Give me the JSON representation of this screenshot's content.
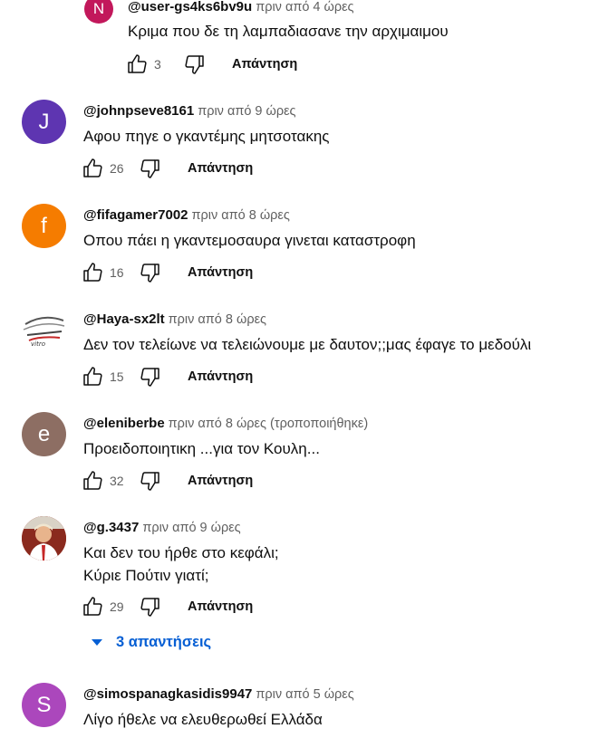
{
  "reply_label": "Απάντηση",
  "comments": [
    {
      "initial": "N",
      "avatar_color": "#c2185b",
      "handle": "@user-gs4ks6bv9u",
      "time": "πριν από 4 ώρες",
      "text": [
        "Κριμα που δε τη λαμπαδιασανε την αρχιμαιμου"
      ],
      "likes": "3"
    },
    {
      "initial": "J",
      "avatar_color": "#5e35b1",
      "handle": "@johnpseve8161",
      "time": "πριν από 9 ώρες",
      "text": [
        "Αφου πηγε ο γκαντέμης μητσοτακης"
      ],
      "likes": "26"
    },
    {
      "initial": "f",
      "avatar_color": "#f57c00",
      "handle": "@fifagamer7002",
      "time": "πριν από 8 ώρες",
      "text": [
        "Οπου πάει η γκαντεμοσαυρα γινεται καταστροφη"
      ],
      "likes": "16"
    },
    {
      "initial": "",
      "avatar_color": "#ffffff",
      "avatar_icon": "car-logo-icon",
      "handle": "@Haya-sx2lt",
      "time": "πριν από 8 ώρες",
      "text": [
        "Δεν τον τελείωνε να τελειώνουμε με δαυτον;;μας έφαγε το μεδούλι"
      ],
      "likes": "15"
    },
    {
      "initial": "e",
      "avatar_color": "#8d6e63",
      "handle": "@eleniberbe",
      "time": "πριν από 8 ώρες",
      "edited": "(τροποποιήθηκε)",
      "text": [
        "Προειδοποιητικη ...για τον Κουλη..."
      ],
      "likes": "32"
    },
    {
      "initial": "",
      "avatar_color": "#b23a2a",
      "avatar_icon": "profile-photo-icon",
      "handle": "@g.3437",
      "time": "πριν από 9 ώρες",
      "text": [
        "Και δεν του ήρθε στο κεφάλι;",
        "Κύριε Πούτιν γιατί;"
      ],
      "likes": "29"
    },
    {
      "initial": "S",
      "avatar_color": "#ab47bc",
      "handle": "@simospanagkasidis9947",
      "time": "πριν από 5 ώρες",
      "text": [
        "Λίγο ήθελε να ελευθερωθεί Ελλάδα"
      ],
      "likes": ""
    }
  ],
  "replies_toggle": {
    "label": "3 απαντήσεις",
    "icon": "caret-down-icon"
  }
}
